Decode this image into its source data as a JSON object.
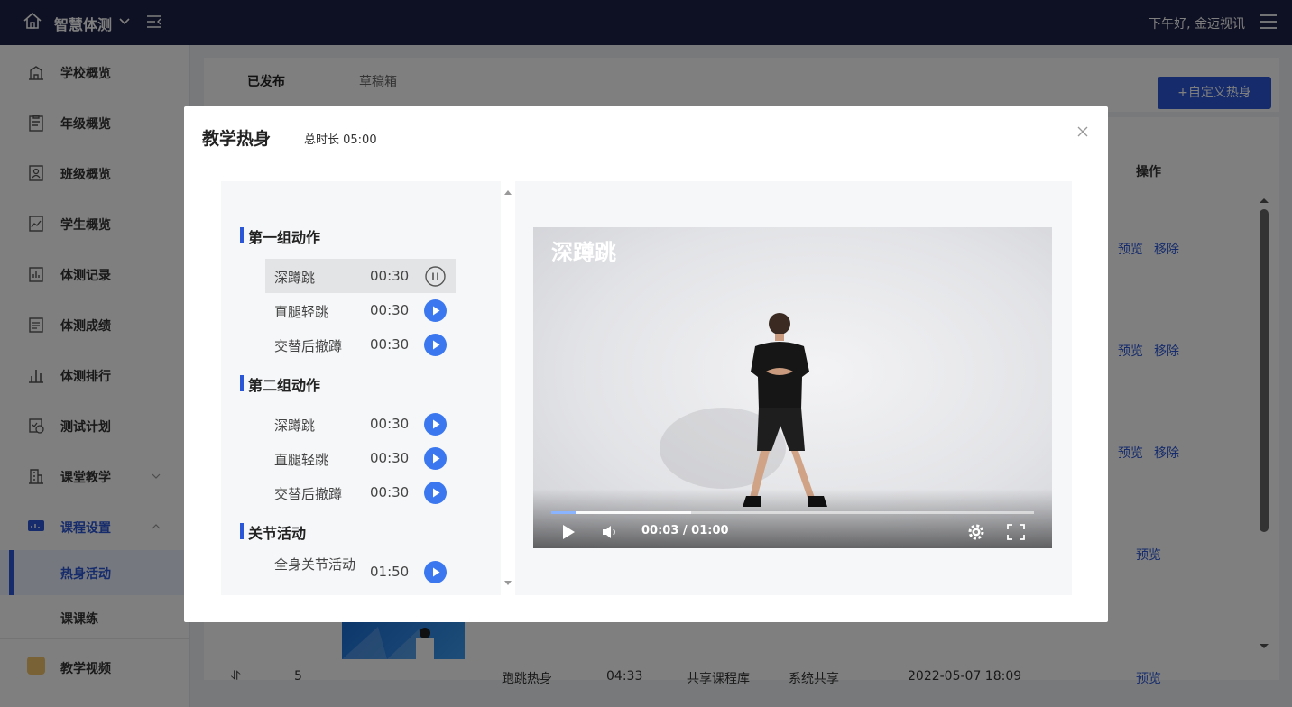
{
  "topbar": {
    "brand": "智慧体测",
    "greeting": "下午好, 金迈视讯"
  },
  "sidebar": {
    "items": [
      {
        "label": "学校概览",
        "icon": "school-icon"
      },
      {
        "label": "年级概览",
        "icon": "clipboard-icon"
      },
      {
        "label": "班级概览",
        "icon": "class-icon"
      },
      {
        "label": "学生概览",
        "icon": "student-chart-icon"
      },
      {
        "label": "体测记录",
        "icon": "record-icon"
      },
      {
        "label": "体测成绩",
        "icon": "score-icon"
      },
      {
        "label": "体测排行",
        "icon": "ranking-icon"
      },
      {
        "label": "测试计划",
        "icon": "plan-icon"
      },
      {
        "label": "课堂教学",
        "icon": "building-icon"
      },
      {
        "label": "课程设置",
        "icon": "course-settings-icon"
      }
    ],
    "sub_items": [
      {
        "label": "热身活动"
      },
      {
        "label": "课课练"
      }
    ],
    "video_label": "教学视频"
  },
  "main": {
    "tabs": [
      {
        "label": "已发布"
      },
      {
        "label": "草稿箱"
      }
    ],
    "custom_button": "+自定义热身",
    "col_ops": "操作",
    "ops": {
      "preview": "预览",
      "remove": "移除"
    },
    "last_row": {
      "index": "5",
      "name": "跑跳热身",
      "duration": "04:33",
      "source": "共享课程库",
      "share": "系统共享",
      "date": "2022-05-07 18:09",
      "preview": "预览"
    }
  },
  "modal": {
    "title": "教学热身",
    "total": "总时长 05:00",
    "groups": [
      {
        "title": "第一组动作",
        "items": [
          {
            "name": "深蹲跳",
            "duration": "00:30",
            "state": "playing"
          },
          {
            "name": "直腿轻跳",
            "duration": "00:30",
            "state": "idle"
          },
          {
            "name": "交替后撤蹲",
            "duration": "00:30",
            "state": "idle"
          }
        ]
      },
      {
        "title": "第二组动作",
        "items": [
          {
            "name": "深蹲跳",
            "duration": "00:30",
            "state": "idle"
          },
          {
            "name": "直腿轻跳",
            "duration": "00:30",
            "state": "idle"
          },
          {
            "name": "交替后撤蹲",
            "duration": "00:30",
            "state": "idle"
          }
        ]
      },
      {
        "title": "关节活动",
        "items": [
          {
            "name": "全身关节活动",
            "duration": "01:50",
            "state": "idle"
          }
        ]
      }
    ],
    "video": {
      "title": "深蹲跳",
      "timecode": "00:03 / 01:00",
      "played_fraction": 0.05,
      "buffered_fraction": 0.29
    }
  },
  "colors": {
    "accent": "#2b57d6",
    "topbar": "#1d2347",
    "play": "#3b78f0"
  }
}
